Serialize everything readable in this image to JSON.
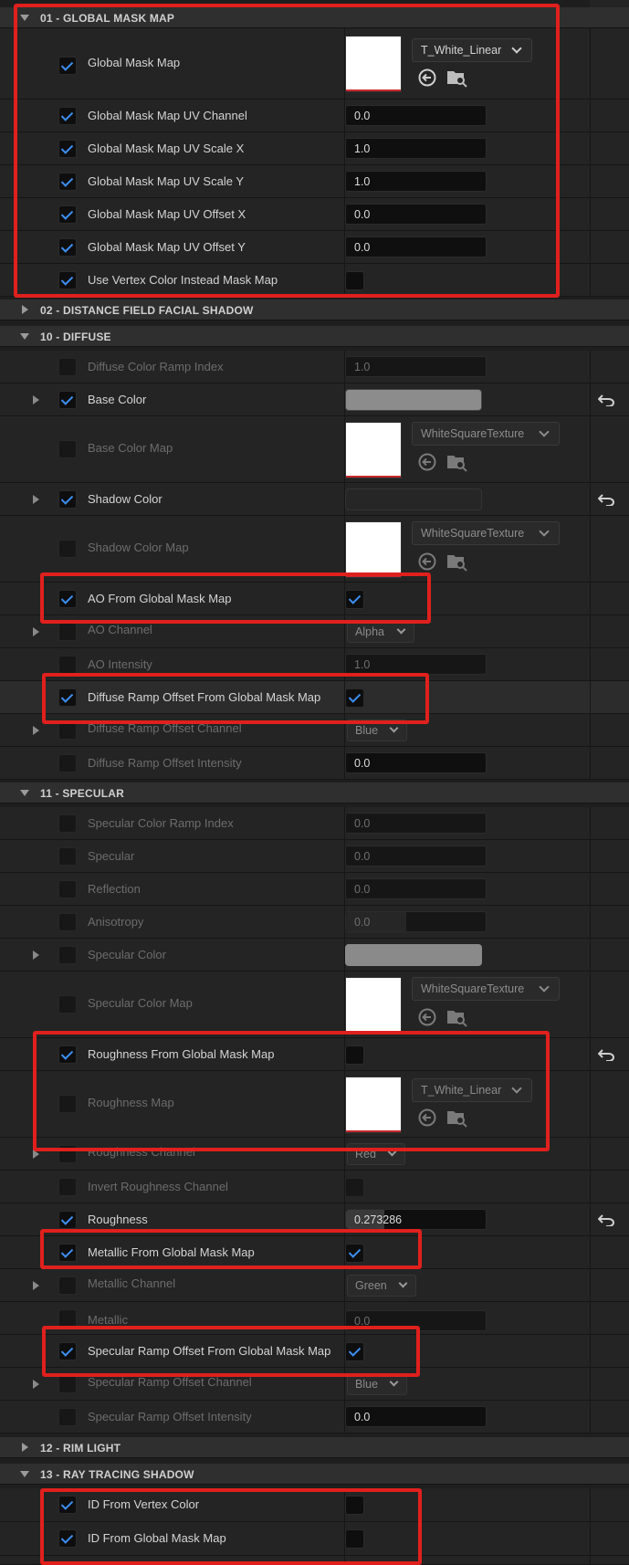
{
  "sections": [
    {
      "id": "s01",
      "title": "01 - GLOBAL MASK MAP",
      "expanded": true
    },
    {
      "id": "s02",
      "title": "02 - DISTANCE FIELD FACIAL SHADOW",
      "expanded": false
    },
    {
      "id": "s10",
      "title": "10 - DIFFUSE",
      "expanded": true
    },
    {
      "id": "s11",
      "title": "11 - SPECULAR",
      "expanded": true
    },
    {
      "id": "s12",
      "title": "12 - RIM LIGHT",
      "expanded": false
    },
    {
      "id": "s13",
      "title": "13 - RAY TRACING SHADOW",
      "expanded": true
    }
  ],
  "global_mask": {
    "map": {
      "label": "Global Mask Map",
      "checked": true,
      "texture": "T_White_Linear"
    },
    "uv_channel": {
      "label": "Global Mask Map UV Channel",
      "checked": true,
      "value": "0.0"
    },
    "uv_scale_x": {
      "label": "Global Mask Map UV Scale X",
      "checked": true,
      "value": "1.0"
    },
    "uv_scale_y": {
      "label": "Global Mask Map UV Scale Y",
      "checked": true,
      "value": "1.0"
    },
    "uv_offset_x": {
      "label": "Global Mask Map UV Offset X",
      "checked": true,
      "value": "0.0"
    },
    "uv_offset_y": {
      "label": "Global Mask Map UV Offset Y",
      "checked": true,
      "value": "0.0"
    },
    "use_vertex_color": {
      "label": "Use Vertex Color Instead Mask Map",
      "checked": true,
      "value_checked": false
    }
  },
  "diffuse": {
    "ramp_index": {
      "label": "Diffuse Color Ramp Index",
      "checked": false,
      "value": "1.0"
    },
    "base_color": {
      "label": "Base Color",
      "checked": true,
      "color": "#8c8c8c"
    },
    "base_color_map": {
      "label": "Base Color Map",
      "checked": false,
      "texture": "WhiteSquareTexture"
    },
    "shadow_color": {
      "label": "Shadow Color",
      "checked": true,
      "color": "#262626"
    },
    "shadow_color_map": {
      "label": "Shadow Color Map",
      "checked": false,
      "texture": "WhiteSquareTexture"
    },
    "ao_from_mask": {
      "label": "AO From Global Mask Map",
      "checked": true,
      "value_checked": true
    },
    "ao_channel": {
      "label": "AO Channel",
      "checked": false,
      "value": "Alpha"
    },
    "ao_intensity": {
      "label": "AO Intensity",
      "checked": false,
      "value": "1.0"
    },
    "ramp_offset_from_mask": {
      "label": "Diffuse Ramp Offset From Global Mask Map",
      "checked": true,
      "value_checked": true
    },
    "ramp_offset_channel": {
      "label": "Diffuse Ramp Offset Channel",
      "checked": false,
      "value": "Blue"
    },
    "ramp_offset_intensity": {
      "label": "Diffuse Ramp Offset Intensity",
      "checked": false,
      "value": "0.0"
    }
  },
  "specular": {
    "ramp_index": {
      "label": "Specular Color Ramp Index",
      "checked": false,
      "value": "0.0"
    },
    "specular": {
      "label": "Specular",
      "checked": false,
      "value": "0.0"
    },
    "reflection": {
      "label": "Reflection",
      "checked": false,
      "value": "0.0"
    },
    "anisotropy": {
      "label": "Anisotropy",
      "checked": false,
      "value": "0.0"
    },
    "color": {
      "label": "Specular Color",
      "checked": false,
      "color": "#8a8a8a"
    },
    "color_map": {
      "label": "Specular Color Map",
      "checked": false,
      "texture": "WhiteSquareTexture"
    },
    "roughness_from_mask": {
      "label": "Roughness From Global Mask Map",
      "checked": true,
      "value_checked": false
    },
    "roughness_map": {
      "label": "Roughness Map",
      "checked": false,
      "texture": "T_White_Linear"
    },
    "roughness_channel": {
      "label": "Roughness Channel",
      "checked": false,
      "value": "Red"
    },
    "invert_roughness": {
      "label": "Invert Roughness Channel",
      "checked": false,
      "value_checked": false
    },
    "roughness": {
      "label": "Roughness",
      "checked": true,
      "value": "0.273286"
    },
    "metallic_from_mask": {
      "label": "Metallic From Global Mask Map",
      "checked": true,
      "value_checked": true
    },
    "metallic_channel": {
      "label": "Metallic Channel",
      "checked": false,
      "value": "Green"
    },
    "metallic": {
      "label": "Metallic",
      "checked": false,
      "value": "0.0"
    },
    "ramp_offset_from_mask": {
      "label": "Specular Ramp Offset From Global Mask Map",
      "checked": true,
      "value_checked": true
    },
    "ramp_offset_channel": {
      "label": "Specular Ramp Offset Channel",
      "checked": false,
      "value": "Blue"
    },
    "ramp_offset_intensity": {
      "label": "Specular Ramp Offset Intensity",
      "checked": false,
      "value": "0.0"
    }
  },
  "ray_tracing": {
    "id_from_vertex": {
      "label": "ID From Vertex Color",
      "checked": true,
      "value_checked": false
    },
    "id_from_mask": {
      "label": "ID From Global Mask Map",
      "checked": true,
      "value_checked": false
    }
  },
  "icons": {
    "use_selected": "arrow-left-circle-icon",
    "browse": "folder-search-icon",
    "reset": "reset-to-default-icon",
    "expand": "chevron-right-icon",
    "collapse": "chevron-down-icon"
  },
  "colors": {
    "highlight": "#e0201d",
    "check": "#3d8ef0"
  }
}
